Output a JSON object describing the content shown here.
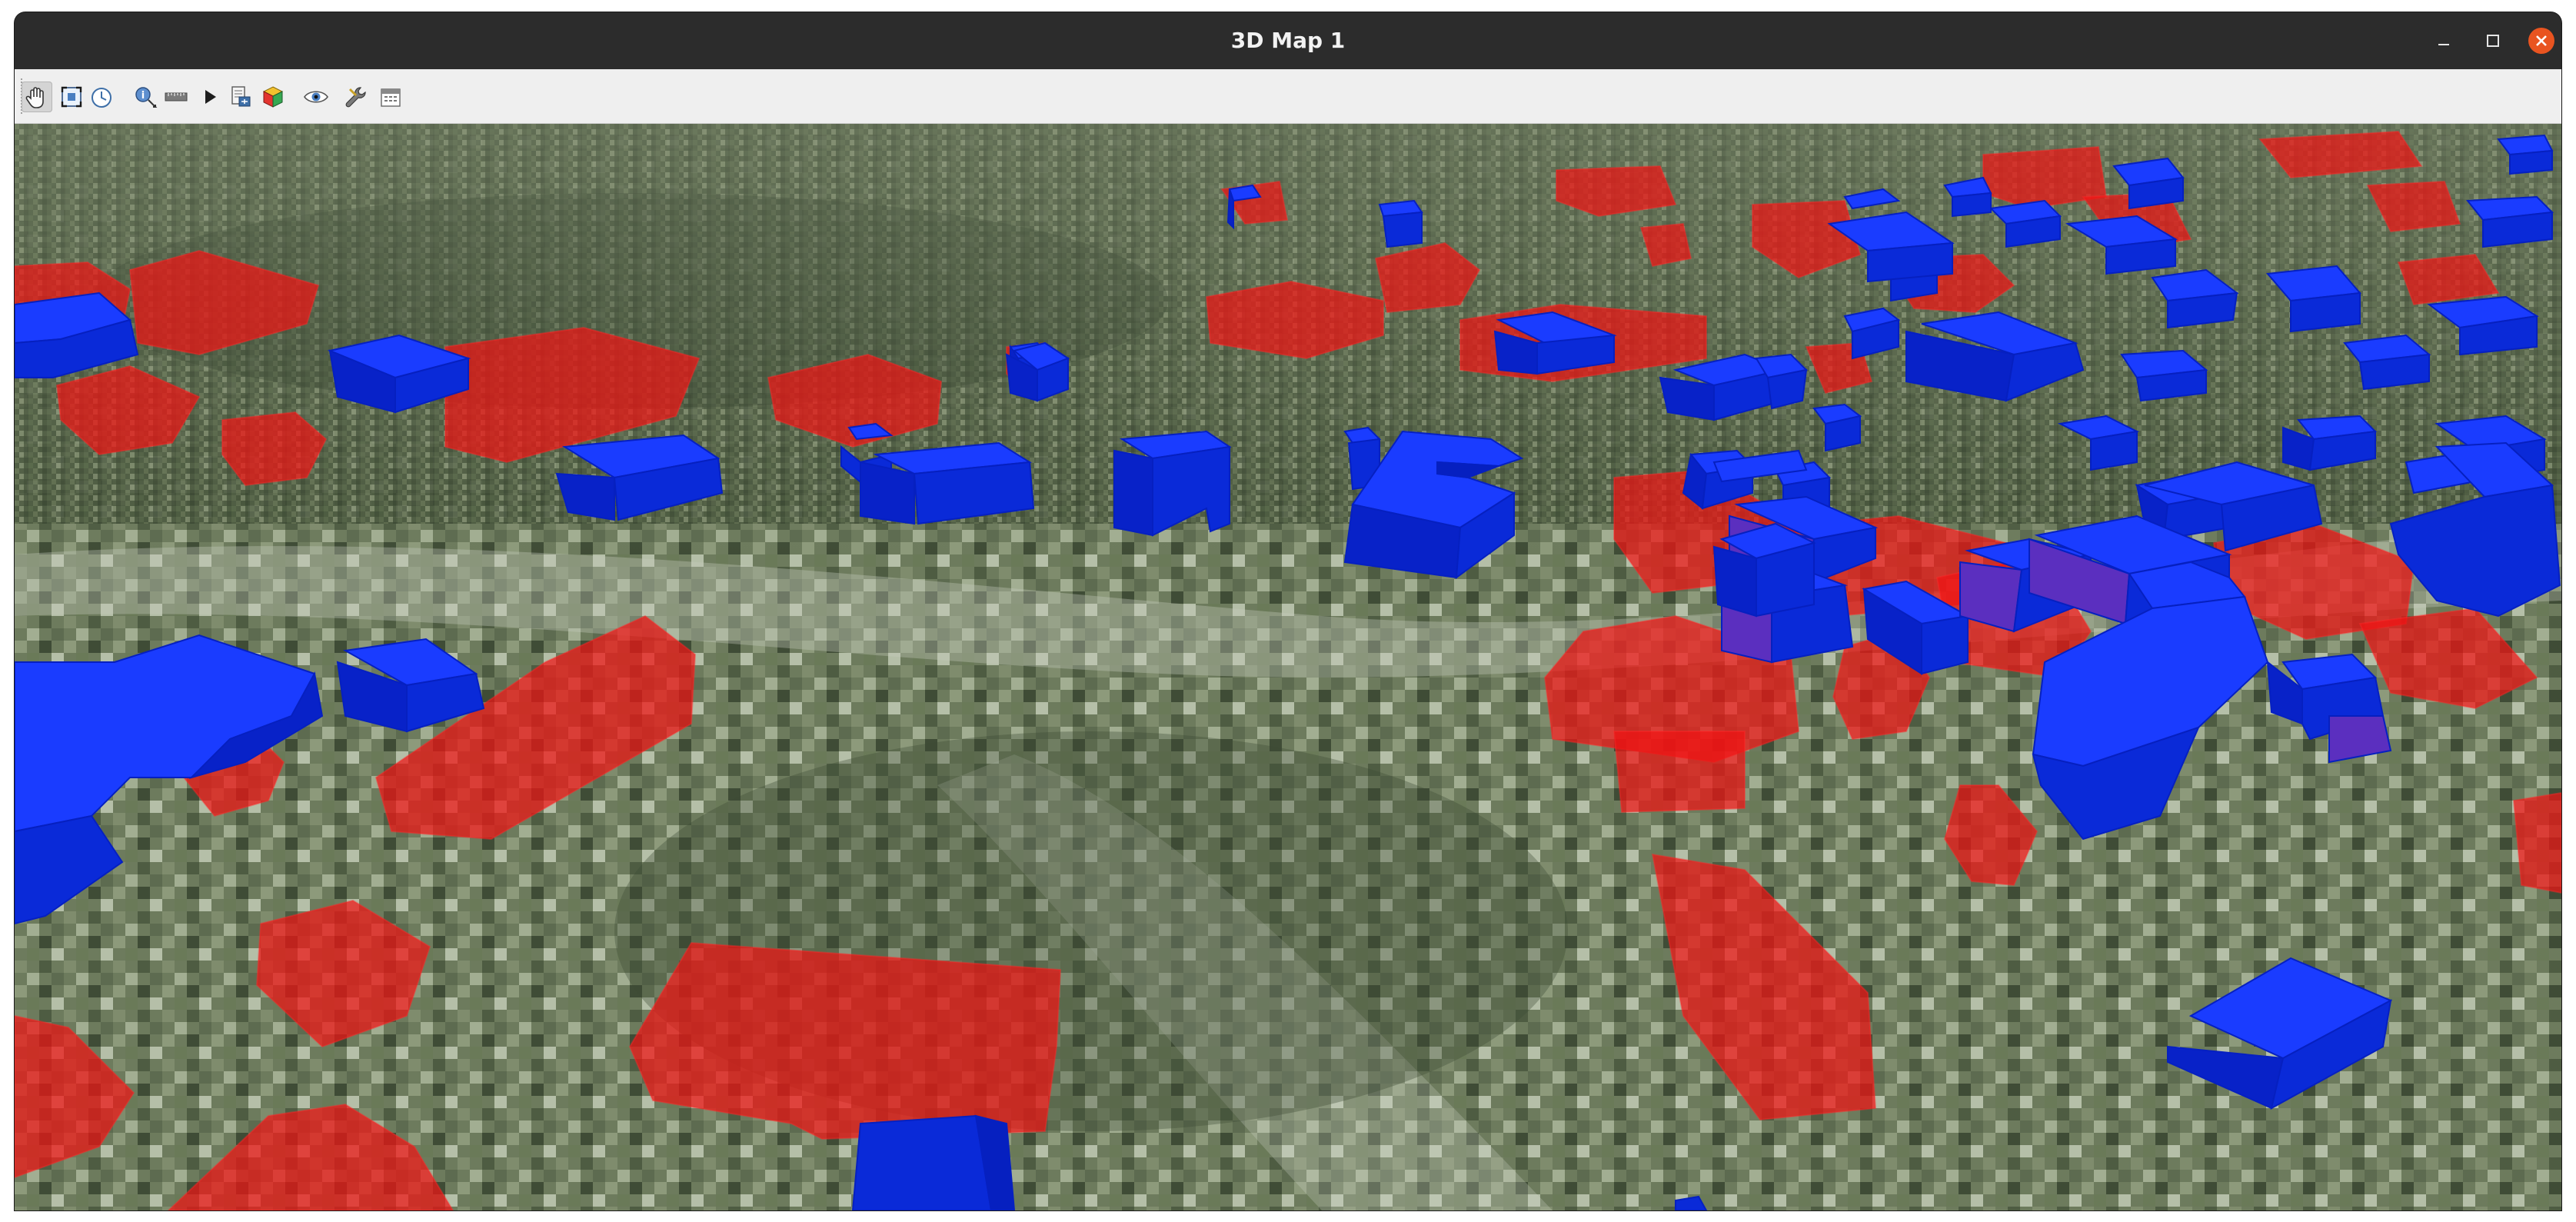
{
  "window": {
    "title": "3D Map 1",
    "controls": [
      "minimize-icon",
      "maximize-icon",
      "close-icon"
    ],
    "close_color": "#e95420"
  },
  "toolbar": {
    "tools": [
      {
        "name": "pan-tool",
        "icon": "hand-icon",
        "active": true
      },
      {
        "name": "zoom-full",
        "icon": "zoom-full-icon"
      },
      {
        "name": "toggle-camera",
        "icon": "clock-icon"
      },
      {
        "name": "identify-tool",
        "icon": "identify-icon"
      },
      {
        "name": "measure-tool",
        "icon": "ruler-icon"
      },
      {
        "name": "animations",
        "icon": "play-icon"
      },
      {
        "name": "export-scene",
        "icon": "export-icon"
      },
      {
        "name": "map-themes",
        "icon": "cube-icon"
      },
      {
        "name": "camera-visibility",
        "icon": "eye-icon"
      },
      {
        "name": "configure",
        "icon": "wrench-icon"
      },
      {
        "name": "options",
        "icon": "calendar-icon"
      }
    ]
  },
  "scene": {
    "terrain": "satellite-imagery",
    "colors": {
      "building_blue": "#0a2ef0",
      "building_red": "#f01414",
      "terrain_dark": "#3d4a34",
      "terrain_light": "#a9b69c"
    },
    "layers": [
      {
        "name": "blue-buildings",
        "color": "#0a2ef0"
      },
      {
        "name": "red-buildings",
        "color": "#f01414",
        "opacity": 0.75
      }
    ]
  }
}
